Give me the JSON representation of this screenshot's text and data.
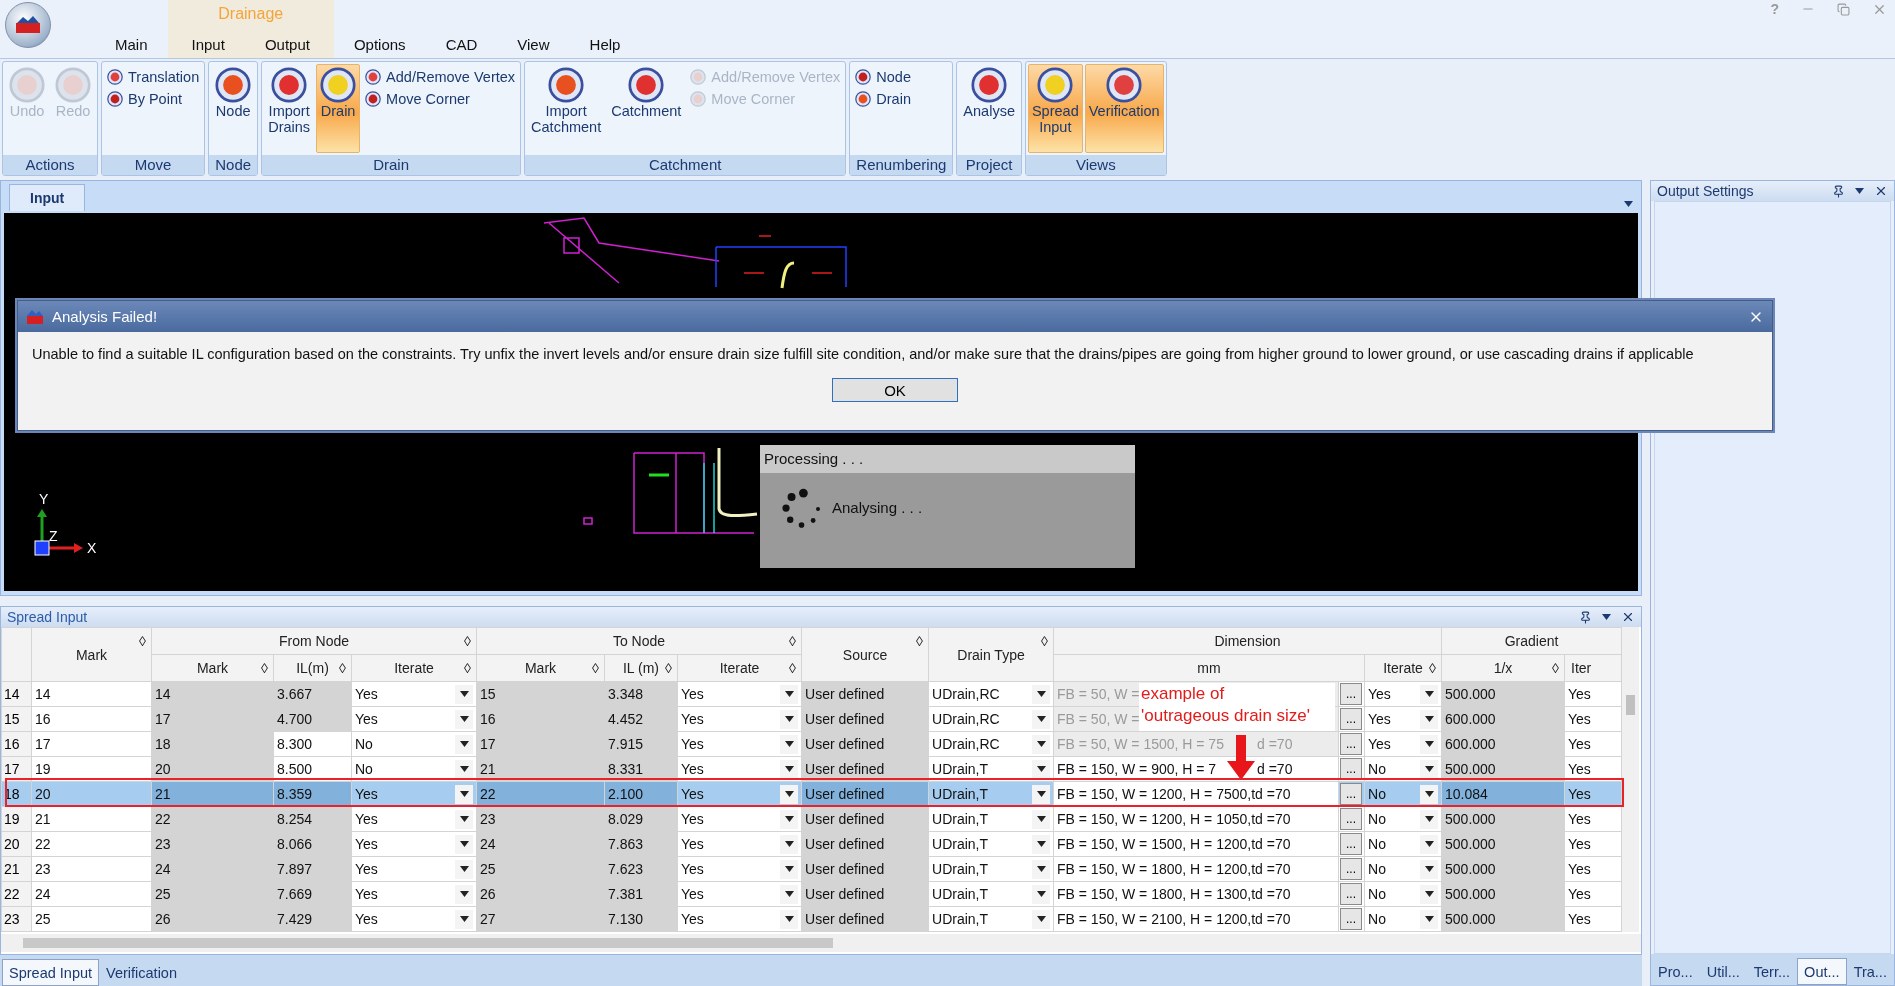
{
  "window": {
    "help": "?"
  },
  "menu": {
    "context_label": "Drainage",
    "tabs": [
      {
        "label": "Main",
        "contextual": false
      },
      {
        "label": "Input",
        "contextual": true
      },
      {
        "label": "Output",
        "contextual": true
      },
      {
        "label": "Options",
        "contextual": false
      },
      {
        "label": "CAD",
        "contextual": false
      },
      {
        "label": "View",
        "contextual": false
      },
      {
        "label": "Help",
        "contextual": false
      }
    ]
  },
  "ribbon": {
    "groups": [
      {
        "label": "Actions",
        "items": [
          {
            "kind": "large",
            "label": "Undo",
            "disabled": true,
            "selected": false
          },
          {
            "kind": "large",
            "label": "Redo",
            "disabled": true,
            "selected": false
          }
        ]
      },
      {
        "label": "Move",
        "items": [
          {
            "kind": "stack",
            "items": [
              {
                "label": "Translation",
                "disabled": false
              },
              {
                "label": "By Point",
                "disabled": false
              }
            ]
          }
        ]
      },
      {
        "label": "Node",
        "items": [
          {
            "kind": "large",
            "label": "Node",
            "disabled": false,
            "selected": false
          }
        ]
      },
      {
        "label": "Drain",
        "items": [
          {
            "kind": "large",
            "label": "Import\nDrains",
            "disabled": false,
            "selected": false
          },
          {
            "kind": "large",
            "label": "Drain",
            "disabled": false,
            "selected": true
          },
          {
            "kind": "stack",
            "items": [
              {
                "label": "Add/Remove Vertex",
                "disabled": false
              },
              {
                "label": "Move Corner",
                "disabled": false
              }
            ]
          }
        ]
      },
      {
        "label": "Catchment",
        "items": [
          {
            "kind": "large",
            "label": "Import\nCatchment",
            "disabled": false,
            "selected": false
          },
          {
            "kind": "large",
            "label": "Catchment",
            "disabled": false,
            "selected": false
          },
          {
            "kind": "stack",
            "items": [
              {
                "label": "Add/Remove Vertex",
                "disabled": true
              },
              {
                "label": "Move Corner",
                "disabled": true
              }
            ]
          }
        ]
      },
      {
        "label": "Renumbering",
        "items": [
          {
            "kind": "stack",
            "items": [
              {
                "label": "Node",
                "disabled": false
              },
              {
                "label": "Drain",
                "disabled": false
              }
            ]
          }
        ]
      },
      {
        "label": "Project",
        "items": [
          {
            "kind": "large",
            "label": "Analyse",
            "disabled": false,
            "selected": false
          }
        ]
      },
      {
        "label": "Views",
        "items": [
          {
            "kind": "large",
            "label": "Spread\nInput",
            "disabled": false,
            "selected": true
          },
          {
            "kind": "large",
            "label": "Verification",
            "disabled": false,
            "selected": true
          }
        ]
      }
    ]
  },
  "document": {
    "tab": "Input",
    "axis_labels": {
      "y": "Y",
      "z": "Z",
      "x": "X"
    },
    "progress": {
      "title": "Processing . . .",
      "message": "Analysing . . ."
    }
  },
  "dialog": {
    "title": "Analysis Failed!",
    "message": "Unable to find a suitable IL configuration based on the constraints. Try unfix the invert levels and/or ensure drain size fulfill site condition, and/or make sure that the drains/pipes are going from higher ground to lower ground, or use cascading drains if applicable",
    "button": "OK"
  },
  "spread_input": {
    "title": "Spread Input",
    "headers": {
      "mark": "Mark",
      "from_node": "From Node",
      "to_node": "To Node",
      "source": "Source",
      "drain_type": "Drain Type",
      "dimension": "Dimension",
      "gradient": "Gradient",
      "from_mark": "Mark",
      "from_il": "IL(m)",
      "from_iterate": "Iterate",
      "to_mark": "Mark",
      "to_il": "IL (m)",
      "to_iterate": "Iterate",
      "mm": "mm",
      "dim_iterate": "Iterate",
      "one_over_x": "1/x",
      "column_15": "Iter",
      "sort_mark": "◊"
    },
    "annotation": {
      "text": "example of\n'outrageous drain size'"
    },
    "rows": [
      {
        "num": "14",
        "mark": "14",
        "from_mark": "14",
        "from_il": "3.667",
        "from_il_editable": false,
        "from_iterate": "Yes",
        "to_mark": "15",
        "to_il": "3.348",
        "to_iterate": "Yes",
        "source": "User defined",
        "drain_type": "UDrain,RC",
        "dimension": "FB = 50, W =",
        "dimension_disabled": true,
        "edit": "...",
        "dim_iterate": "Yes",
        "gradient": "500.000",
        "column_15": "Yes",
        "selected": false
      },
      {
        "num": "15",
        "mark": "16",
        "from_mark": "17",
        "from_il": "4.700",
        "from_il_editable": false,
        "from_iterate": "Yes",
        "to_mark": "16",
        "to_il": "4.452",
        "to_iterate": "Yes",
        "source": "User defined",
        "drain_type": "UDrain,RC",
        "dimension": "FB = 50, W =",
        "dimension_disabled": true,
        "edit": "...",
        "dim_iterate": "Yes",
        "gradient": "600.000",
        "column_15": "Yes",
        "selected": false
      },
      {
        "num": "16",
        "mark": "17",
        "from_mark": "18",
        "from_il": "8.300",
        "from_il_editable": true,
        "from_iterate": "No",
        "to_mark": "17",
        "to_il": "7.915",
        "to_iterate": "Yes",
        "source": "User defined",
        "drain_type": "UDrain,RC",
        "dimension": "FB = 50, W = 1500, H = 75",
        "dimension_tail": "d =70",
        "dimension_disabled": true,
        "edit": "...",
        "dim_iterate": "Yes",
        "gradient": "600.000",
        "column_15": "Yes",
        "selected": false
      },
      {
        "num": "17",
        "mark": "19",
        "from_mark": "20",
        "from_il": "8.500",
        "from_il_editable": true,
        "from_iterate": "No",
        "to_mark": "21",
        "to_il": "8.331",
        "to_iterate": "Yes",
        "source": "User defined",
        "drain_type": "UDrain,T",
        "dimension": "FB = 150, W = 900, H = 7",
        "dimension_tail": "d =70",
        "dimension_disabled": false,
        "edit": "...",
        "dim_iterate": "No",
        "gradient": "500.000",
        "column_15": "Yes",
        "selected": false
      },
      {
        "num": "18",
        "mark": "20",
        "from_mark": "21",
        "from_il": "8.359",
        "from_il_editable": false,
        "from_iterate": "Yes",
        "to_mark": "22",
        "to_il": "2.100",
        "to_iterate": "Yes",
        "source": "User defined",
        "drain_type": "UDrain,T",
        "dimension": "FB = 150, W = 1200, H = 7500,td =70",
        "dimension_disabled": false,
        "edit": "...",
        "dim_iterate": "No",
        "gradient": "10.084",
        "column_15": "Yes",
        "selected": true,
        "outlined": true
      },
      {
        "num": "19",
        "mark": "21",
        "from_mark": "22",
        "from_il": "8.254",
        "from_il_editable": false,
        "from_iterate": "Yes",
        "to_mark": "23",
        "to_il": "8.029",
        "to_iterate": "Yes",
        "source": "User defined",
        "drain_type": "UDrain,T",
        "dimension": "FB = 150, W = 1200, H = 1050,td =70",
        "dimension_disabled": false,
        "edit": "...",
        "dim_iterate": "No",
        "gradient": "500.000",
        "column_15": "Yes",
        "selected": false
      },
      {
        "num": "20",
        "mark": "22",
        "from_mark": "23",
        "from_il": "8.066",
        "from_il_editable": false,
        "from_iterate": "Yes",
        "to_mark": "24",
        "to_il": "7.863",
        "to_iterate": "Yes",
        "source": "User defined",
        "drain_type": "UDrain,T",
        "dimension": "FB = 150, W = 1500, H = 1200,td =70",
        "dimension_disabled": false,
        "edit": "...",
        "dim_iterate": "No",
        "gradient": "500.000",
        "column_15": "Yes",
        "selected": false
      },
      {
        "num": "21",
        "mark": "23",
        "from_mark": "24",
        "from_il": "7.897",
        "from_il_editable": false,
        "from_iterate": "Yes",
        "to_mark": "25",
        "to_il": "7.623",
        "to_iterate": "Yes",
        "source": "User defined",
        "drain_type": "UDrain,T",
        "dimension": "FB = 150, W = 1800, H = 1200,td =70",
        "dimension_disabled": false,
        "edit": "...",
        "dim_iterate": "No",
        "gradient": "500.000",
        "column_15": "Yes",
        "selected": false
      },
      {
        "num": "22",
        "mark": "24",
        "from_mark": "25",
        "from_il": "7.669",
        "from_il_editable": false,
        "from_iterate": "Yes",
        "to_mark": "26",
        "to_il": "7.381",
        "to_iterate": "Yes",
        "source": "User defined",
        "drain_type": "UDrain,T",
        "dimension": "FB = 150, W = 1800, H = 1300,td =70",
        "dimension_disabled": false,
        "edit": "...",
        "dim_iterate": "No",
        "gradient": "500.000",
        "column_15": "Yes",
        "selected": false
      },
      {
        "num": "23",
        "mark": "25",
        "from_mark": "26",
        "from_il": "7.429",
        "from_il_editable": false,
        "from_iterate": "Yes",
        "to_mark": "27",
        "to_il": "7.130",
        "to_iterate": "Yes",
        "source": "User defined",
        "drain_type": "UDrain,T",
        "dimension": "FB = 150, W = 2100, H = 1200,td =70",
        "dimension_disabled": false,
        "edit": "...",
        "dim_iterate": "No",
        "gradient": "500.000",
        "column_15": "Yes",
        "selected": false
      }
    ]
  },
  "bottom_tabs": [
    {
      "label": "Spread Input",
      "selected": true
    },
    {
      "label": "Verification",
      "selected": false
    }
  ],
  "output_settings": {
    "title": "Output Settings",
    "tabs": [
      {
        "label": "Pro...",
        "selected": false
      },
      {
        "label": "Util...",
        "selected": false
      },
      {
        "label": "Terr...",
        "selected": false
      },
      {
        "label": "Out...",
        "selected": true
      },
      {
        "label": "Tra...",
        "selected": false
      }
    ]
  }
}
